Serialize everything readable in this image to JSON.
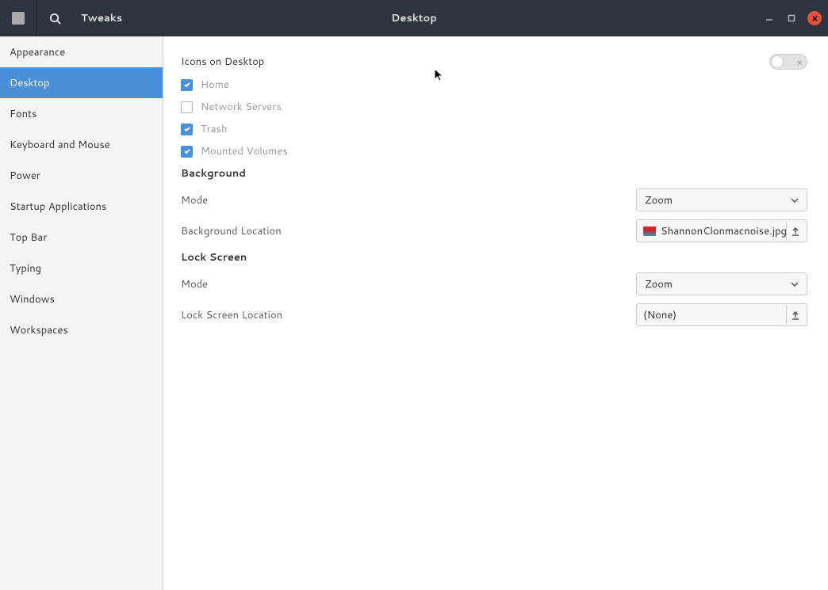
{
  "header": {
    "app_title": "Tweaks",
    "window_title": "Desktop"
  },
  "sidebar": {
    "items": [
      {
        "label": "Appearance",
        "active": false
      },
      {
        "label": "Desktop",
        "active": true
      },
      {
        "label": "Fonts",
        "active": false
      },
      {
        "label": "Keyboard and Mouse",
        "active": false
      },
      {
        "label": "Power",
        "active": false
      },
      {
        "label": "Startup Applications",
        "active": false
      },
      {
        "label": "Top Bar",
        "active": false
      },
      {
        "label": "Typing",
        "active": false
      },
      {
        "label": "Windows",
        "active": false
      },
      {
        "label": "Workspaces",
        "active": false
      }
    ]
  },
  "content": {
    "icons_section": {
      "title": "Icons on Desktop",
      "toggle_state": "off",
      "toggle_mark": "×",
      "checkboxes": [
        {
          "label": "Home",
          "checked": true
        },
        {
          "label": "Network Servers",
          "checked": false
        },
        {
          "label": "Trash",
          "checked": true
        },
        {
          "label": "Mounted Volumes",
          "checked": true
        }
      ]
    },
    "background_section": {
      "title": "Background",
      "mode_label": "Mode",
      "mode_value": "Zoom",
      "location_label": "Background Location",
      "location_value": "ShannonClonmacnoise.jpg"
    },
    "lockscreen_section": {
      "title": "Lock Screen",
      "mode_label": "Mode",
      "mode_value": "Zoom",
      "location_label": "Lock Screen Location",
      "location_value": "(None)"
    }
  }
}
